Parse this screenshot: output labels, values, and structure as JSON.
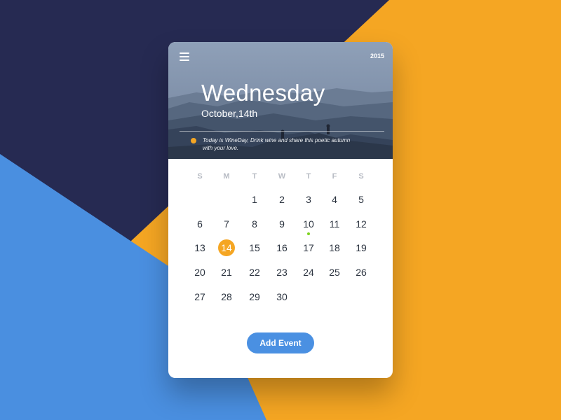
{
  "colors": {
    "navy": "#262a52",
    "orange": "#f5a623",
    "blue": "#4a8fe0",
    "event_dot": "#7ed321",
    "button": "#4a90e2"
  },
  "header": {
    "year": "2015",
    "day_name": "Wednesday",
    "date": "October,14th",
    "note": "Today is WineDay, Drink wine and share this poetic autumn with your love.",
    "menu_icon": "hamburger-menu-icon"
  },
  "calendar": {
    "weekdays": [
      "S",
      "M",
      "T",
      "W",
      "T",
      "F",
      "S"
    ],
    "weeks": [
      [
        "",
        "",
        "",
        "",
        "",
        "",
        ""
      ],
      [
        "",
        "",
        "1",
        "2",
        "3",
        "4",
        "5"
      ],
      [
        "6",
        "7",
        "8",
        "9",
        "10",
        "11",
        "12"
      ],
      [
        "13",
        "14",
        "15",
        "16",
        "17",
        "18",
        "19"
      ],
      [
        "20",
        "21",
        "22",
        "23",
        "24",
        "25",
        "26"
      ],
      [
        "27",
        "28",
        "29",
        "30",
        "",
        "",
        ""
      ]
    ],
    "selected_day": "14",
    "event_days": [
      "10"
    ]
  },
  "actions": {
    "add_event_label": "Add Event"
  }
}
